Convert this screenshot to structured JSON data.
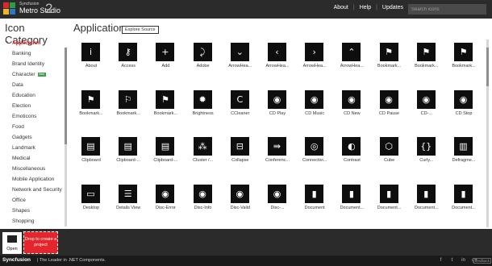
{
  "header": {
    "brand_small": "Syncfusion",
    "brand_name": "Metro Studio",
    "brand_version": "2",
    "links": [
      "About",
      "Help",
      "Updates"
    ],
    "search_placeholder": "Search icons",
    "logo_colors": [
      "#e4252b",
      "#2e9c3f",
      "#f2b51c",
      "#2a79c9"
    ]
  },
  "sidebar": {
    "title": "Icon Category",
    "items": [
      {
        "label": "Application",
        "active": true
      },
      {
        "label": "Banking"
      },
      {
        "label": "Brand Identity"
      },
      {
        "label": "Character",
        "badge": "New"
      },
      {
        "label": "Data"
      },
      {
        "label": "Education"
      },
      {
        "label": "Election"
      },
      {
        "label": "Emoticons"
      },
      {
        "label": "Food"
      },
      {
        "label": "Gadgets"
      },
      {
        "label": "Landmark"
      },
      {
        "label": "Medical"
      },
      {
        "label": "Miscellaneous"
      },
      {
        "label": "Mobile Application"
      },
      {
        "label": "Network and Security"
      },
      {
        "label": "Office"
      },
      {
        "label": "Shapes"
      },
      {
        "label": "Shopping"
      }
    ]
  },
  "main": {
    "title": "Application",
    "explore_label": "Explore Source",
    "icons": [
      {
        "label": "About",
        "glyph": "i",
        "icon": "info-icon"
      },
      {
        "label": "Access",
        "glyph": "⚷",
        "icon": "key-icon"
      },
      {
        "label": "Add",
        "glyph": "+",
        "icon": "plus-icon"
      },
      {
        "label": "Adobe",
        "glyph": "⤸",
        "icon": "adobe-icon"
      },
      {
        "label": "ArrowHea...",
        "glyph": "⌄",
        "icon": "arrow-down-icon"
      },
      {
        "label": "ArrowHea...",
        "glyph": "‹",
        "icon": "arrow-left-icon"
      },
      {
        "label": "ArrowHea...",
        "glyph": "›",
        "icon": "arrow-right-icon"
      },
      {
        "label": "ArrowHea...",
        "glyph": "⌃",
        "icon": "arrow-up-icon"
      },
      {
        "label": "Bookmark...",
        "glyph": "⚑",
        "icon": "bookmark-icon"
      },
      {
        "label": "Bookmark...",
        "glyph": "⚑",
        "icon": "bookmark-add-icon"
      },
      {
        "label": "Bookmark...",
        "glyph": "⚑",
        "icon": "bookmark-play-icon"
      },
      {
        "label": "Bookmark...",
        "glyph": "⚑",
        "icon": "bookmark-cursor-icon"
      },
      {
        "label": "Bookmark...",
        "glyph": "⚐",
        "icon": "bookmark-pen-icon"
      },
      {
        "label": "Bookmark...",
        "glyph": "⚑",
        "icon": "bookmark-tag-icon"
      },
      {
        "label": "Brightness",
        "glyph": "✹",
        "icon": "brightness-icon"
      },
      {
        "label": "CCleaner",
        "glyph": "C",
        "icon": "ccleaner-icon"
      },
      {
        "label": "CD Play",
        "glyph": "◉",
        "icon": "cd-play-icon"
      },
      {
        "label": "CD Music",
        "glyph": "◉",
        "icon": "cd-music-icon"
      },
      {
        "label": "CD New",
        "glyph": "◉",
        "icon": "cd-new-icon"
      },
      {
        "label": "CD Pause",
        "glyph": "◉",
        "icon": "cd-pause-icon"
      },
      {
        "label": "CD-...",
        "glyph": "◉",
        "icon": "cd-transfer-icon"
      },
      {
        "label": "CD Stop",
        "glyph": "◉",
        "icon": "cd-stop-icon"
      },
      {
        "label": "Clipboard",
        "glyph": "▤",
        "icon": "clipboard-icon"
      },
      {
        "label": "Clipboard-...",
        "glyph": "▤",
        "icon": "clipboard-copy-icon"
      },
      {
        "label": "Clipboard-...",
        "glyph": "▤",
        "icon": "clipboard-paste-icon"
      },
      {
        "label": "Cluster /...",
        "glyph": "⁂",
        "icon": "cluster-icon"
      },
      {
        "label": "Collapse",
        "glyph": "⊟",
        "icon": "collapse-icon"
      },
      {
        "label": "Conferenc...",
        "glyph": "⇛",
        "icon": "conference-icon"
      },
      {
        "label": "Connectivi...",
        "glyph": "◎",
        "icon": "connectivity-icon"
      },
      {
        "label": "Contrast",
        "glyph": "◐",
        "icon": "contrast-icon"
      },
      {
        "label": "Cube",
        "glyph": "⬡",
        "icon": "cube-icon"
      },
      {
        "label": "Curly...",
        "glyph": "{}",
        "icon": "curly-braces-icon"
      },
      {
        "label": "Defragme...",
        "glyph": "▥",
        "icon": "defragment-icon"
      },
      {
        "label": "Desktop",
        "glyph": "▭",
        "icon": "desktop-icon"
      },
      {
        "label": "Details View",
        "glyph": "☰",
        "icon": "details-view-icon"
      },
      {
        "label": "Disc-Error",
        "glyph": "◉",
        "icon": "disc-error-icon"
      },
      {
        "label": "Disc-Info",
        "glyph": "◉",
        "icon": "disc-info-icon"
      },
      {
        "label": "Disc-Valid",
        "glyph": "◉",
        "icon": "disc-valid-icon"
      },
      {
        "label": "Disc-...",
        "glyph": "◉",
        "icon": "disc-icon"
      },
      {
        "label": "Document",
        "glyph": "▮",
        "icon": "document-icon"
      },
      {
        "label": "Document...",
        "glyph": "▮",
        "icon": "document-add-icon"
      },
      {
        "label": "Document...",
        "glyph": "▮",
        "icon": "document-edit-icon"
      },
      {
        "label": "Document...",
        "glyph": "▮",
        "icon": "document-search-icon"
      },
      {
        "label": "Document...",
        "glyph": "▮",
        "icon": "document-delete-icon"
      }
    ]
  },
  "tray": {
    "open_label": "Open",
    "drop_text": "Drop to create a project"
  },
  "footer": {
    "logo_text": "Syncfusion",
    "tagline": "| The Leader in .NET Components.",
    "social_icons": [
      "f",
      "t",
      "in",
      "g+"
    ],
    "feedback_label": "feedback"
  }
}
